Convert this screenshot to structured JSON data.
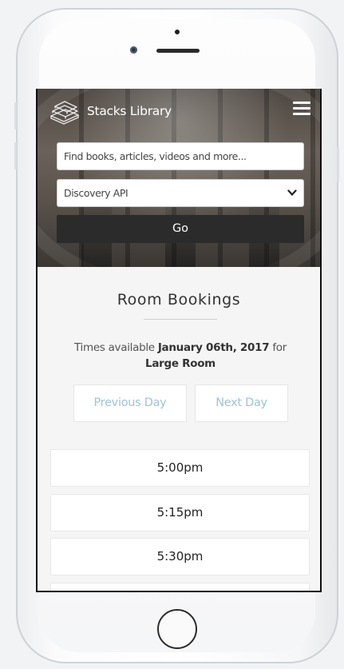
{
  "app": {
    "brand": "Stacks Library"
  },
  "icons": {
    "logo": "books-stack-icon",
    "menu": "hamburger-menu-icon",
    "select": "chevron-down-icon"
  },
  "search": {
    "placeholder": "Find books, articles, videos and more...",
    "source_selected": "Discovery API",
    "go_label": "Go"
  },
  "bookings": {
    "title": "Room Bookings",
    "intro_prefix": "Times available",
    "date": "January 06th, 2017",
    "intro_for": "for",
    "room": "Large Room",
    "prev_label": "Previous Day",
    "next_label": "Next Day",
    "slots": [
      "5:00pm",
      "5:15pm",
      "5:30pm",
      ""
    ]
  },
  "colors": {
    "nav_text": "#9fc3d3",
    "go_button": "#2b2b2b"
  }
}
